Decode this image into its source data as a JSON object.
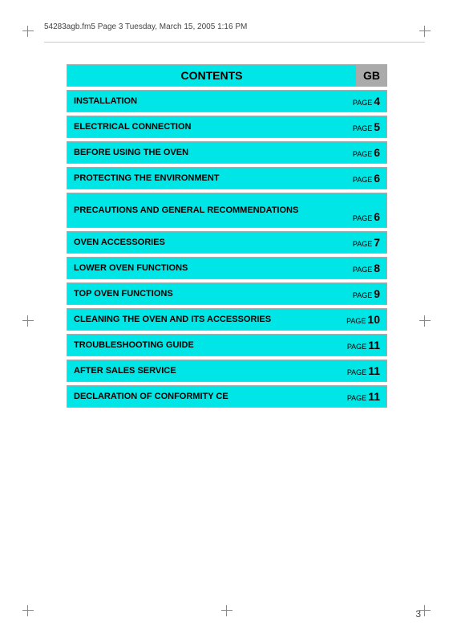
{
  "header": {
    "left_text": "54283agb.fm5  Page 3  Tuesday, March 15, 2005  1:16 PM"
  },
  "title": {
    "main": "CONTENTS",
    "gb": "GB"
  },
  "toc": [
    {
      "label": "INSTALLATION",
      "page": "4"
    },
    {
      "label": "ELECTRICAL CONNECTION",
      "page": "5"
    },
    {
      "label": "BEFORE USING THE OVEN",
      "page": "6"
    },
    {
      "label": "PROTECTING THE ENVIRONMENT",
      "page": "6"
    },
    {
      "label": "PRECAUTIONS AND GENERAL RECOMMENDATIONS",
      "page": "6",
      "tall": true
    },
    {
      "label": "OVEN ACCESSORIES",
      "page": "7"
    },
    {
      "label": "LOWER OVEN FUNCTIONS",
      "page": "8"
    },
    {
      "label": "TOP OVEN FUNCTIONS",
      "page": "9"
    },
    {
      "label": "CLEANING THE OVEN AND ITS ACCESSORIES",
      "page": "10"
    },
    {
      "label": "TROUBLESHOOTING GUIDE",
      "page": "11"
    },
    {
      "label": "AFTER SALES SERVICE",
      "page": "11"
    },
    {
      "label": "DECLARATION OF CONFORMITY CE",
      "page": "11"
    }
  ],
  "page_number": "3"
}
